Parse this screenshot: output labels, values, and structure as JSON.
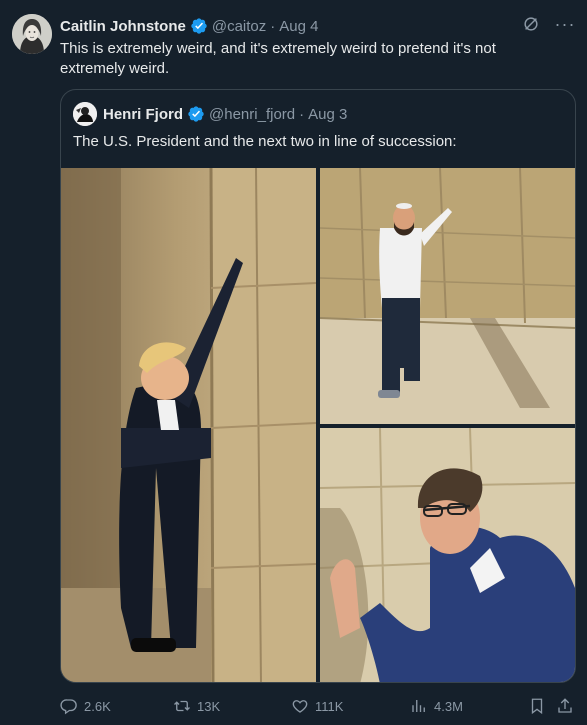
{
  "tweet": {
    "author_name": "Caitlin Johnstone",
    "author_handle": "@caitoz",
    "separator": "·",
    "date": "Aug 4",
    "text": "This is extremely weird, and it's extremely weird to pretend it's not extremely weird."
  },
  "quoted_tweet": {
    "author_name": "Henri Fjord",
    "author_handle": "@henri_fjord",
    "separator": "·",
    "date": "Aug 3",
    "text": "The U.S. President and the next two in line of succession:"
  },
  "actions": {
    "replies": "2.6K",
    "retweets": "13K",
    "likes": "111K",
    "views": "4.3M"
  },
  "icons": {
    "menu": "more-icon",
    "grok": "grok-icon",
    "verified": "verified-badge-icon",
    "reply": "reply-icon",
    "retweet": "retweet-icon",
    "like": "heart-icon",
    "views": "views-icon",
    "bookmark": "bookmark-icon",
    "share": "share-icon"
  },
  "colors": {
    "background": "#15202b",
    "text": "#e7e9ea",
    "muted": "#8b98a5",
    "verified": "#1d9bf0",
    "border": "#38444d"
  }
}
